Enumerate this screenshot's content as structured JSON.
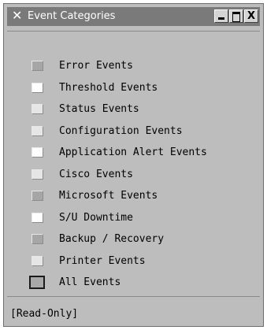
{
  "window": {
    "title": "Event Categories",
    "icon": "x-window-icon",
    "buttons": [
      "minimize-icon",
      "maximize-icon",
      "close-icon"
    ],
    "close_glyph": "X"
  },
  "categories": [
    {
      "label": "Error Events",
      "state": "off"
    },
    {
      "label": "Threshold Events",
      "state": "on"
    },
    {
      "label": "Status Events",
      "state": "light"
    },
    {
      "label": "Configuration Events",
      "state": "light"
    },
    {
      "label": "Application Alert Events",
      "state": "on"
    },
    {
      "label": "Cisco Events",
      "state": "light"
    },
    {
      "label": "Microsoft Events",
      "state": "off"
    },
    {
      "label": "S/U Downtime",
      "state": "on"
    },
    {
      "label": "Backup / Recovery",
      "state": "off"
    },
    {
      "label": "Printer Events",
      "state": "light"
    }
  ],
  "all_events": {
    "label": "All Events"
  },
  "status": "[Read-Only]",
  "colors": {
    "window_bg": "#bdbdbd",
    "titlebar_bg": "#7a7a7a",
    "titlebar_text": "#ffffff"
  }
}
